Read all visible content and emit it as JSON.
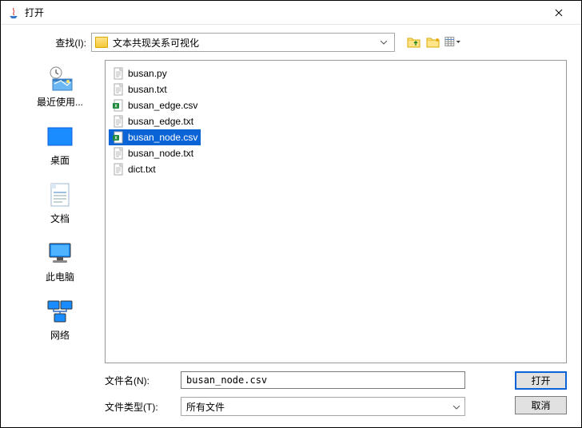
{
  "window": {
    "title": "打开"
  },
  "look_in": {
    "label": "查找(I):",
    "folder": "文本共现关系可视化"
  },
  "sidebar": [
    {
      "key": "recent",
      "label": "最近使用..."
    },
    {
      "key": "desktop",
      "label": "桌面"
    },
    {
      "key": "documents",
      "label": "文档"
    },
    {
      "key": "computer",
      "label": "此电脑"
    },
    {
      "key": "network",
      "label": "网络"
    }
  ],
  "files": [
    {
      "name": "busan.py",
      "type": "txt",
      "selected": false
    },
    {
      "name": "busan.txt",
      "type": "txt",
      "selected": false
    },
    {
      "name": "busan_edge.csv",
      "type": "csv",
      "selected": false
    },
    {
      "name": "busan_edge.txt",
      "type": "txt",
      "selected": false
    },
    {
      "name": "busan_node.csv",
      "type": "csv",
      "selected": true
    },
    {
      "name": "busan_node.txt",
      "type": "txt",
      "selected": false
    },
    {
      "name": "dict.txt",
      "type": "txt",
      "selected": false
    }
  ],
  "file_name": {
    "label": "文件名(N):",
    "value": "busan_node.csv"
  },
  "file_type": {
    "label": "文件类型(T):",
    "value": "所有文件"
  },
  "buttons": {
    "open": "打开",
    "cancel": "取消"
  }
}
